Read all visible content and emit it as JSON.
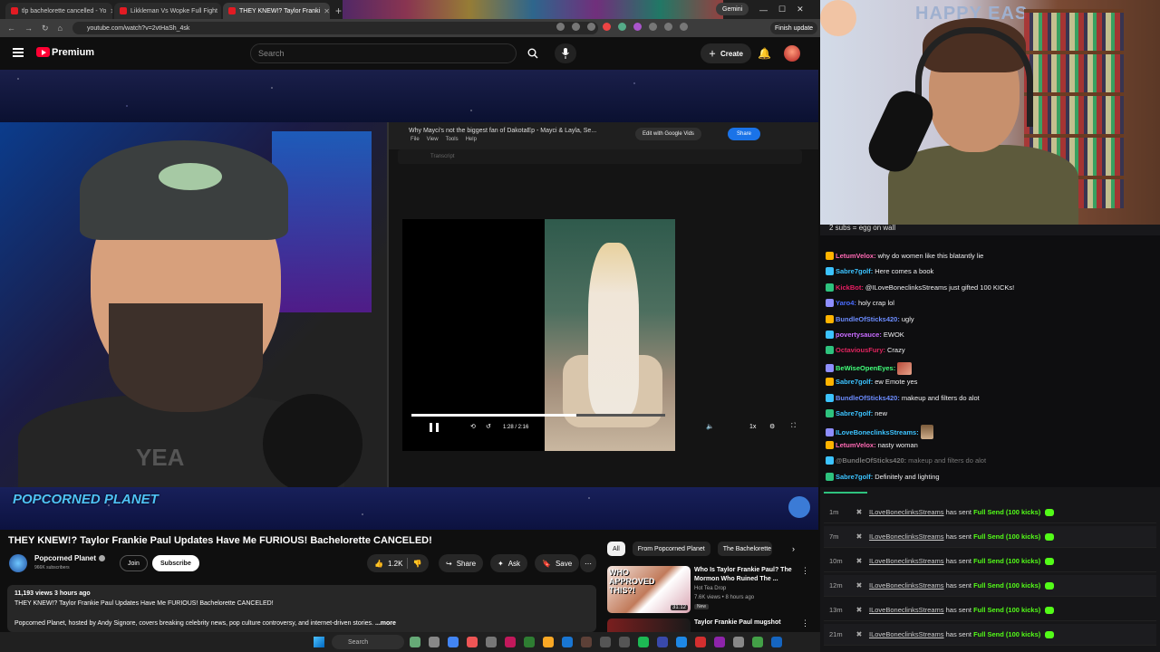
{
  "browser": {
    "tabs": [
      {
        "label": "tlp bachelorette cancelled - Yo"
      },
      {
        "label": "Likkleman Vs Wopke Full Fight"
      },
      {
        "label": "THEY KNEW!? Taylor Franki"
      }
    ],
    "gemini_label": "Gemini",
    "url": "youtube.com/watch?v=2vtHaSh_4sk",
    "finish_update": "Finish update"
  },
  "youtube": {
    "brand": "Premium",
    "search_placeholder": "Search",
    "create_label": "Create"
  },
  "screen_share": {
    "doc_title": "Why Mayci's not the biggest fan of DakotaEp - Mayci & Layla, Se...",
    "doc_menu": [
      "File",
      "View",
      "Tools",
      "Help"
    ],
    "edit_label": "Edit with Google Vids",
    "share_label": "Share",
    "transcript_label": "Transcript",
    "time": "1:28 / 2:16",
    "speed": "1x",
    "progress": 0.65
  },
  "left_cam": {
    "shirt_text": "YEA"
  },
  "banner": {
    "logo": "POPCORNED PLANET"
  },
  "video": {
    "title": "THEY KNEW!? Taylor Frankie Paul Updates Have Me FURIOUS! Bachelorette CANCELED!",
    "channel": "Popcorned Planet",
    "subscribers": "966K subscribers",
    "join": "Join",
    "subscribe": "Subscribe",
    "likes": "1.2K",
    "share": "Share",
    "ask": "Ask",
    "save": "Save",
    "views_time": "11,193 views  3 hours ago",
    "desc_title": "THEY KNEW!? Taylor Frankie Paul Updates Have Me FURIOUS! Bachelorette CANCELED!",
    "desc_body": "Popcorned Planet, hosted by Andy Signore, covers breaking celebrity news, pop culture controversy, and internet-driven stories.",
    "more": "...more"
  },
  "recs": {
    "chips": [
      "All",
      "From Popcorned Planet",
      "The Bachelorette"
    ],
    "items": [
      {
        "thumb_text": "WHO APPROVED THIS?!",
        "duration": "31:12",
        "title": "Who Is Taylor Frankie Paul? The Mormon Who Ruined The ...",
        "channel": "Hot Tea Drop",
        "meta": "7.6K views • 8 hours ago",
        "badge": "New"
      },
      {
        "thumb_text": "",
        "duration": "",
        "title": "Taylor Frankie Paul mugshot",
        "channel": "",
        "meta": "",
        "badge": ""
      }
    ]
  },
  "taskbar": {
    "search": "Search"
  },
  "webcam": {
    "wall_text": "HAPPY EAS"
  },
  "chat": {
    "header": "2 subs = egg on wall",
    "messages": [
      {
        "user": "LetumVelox",
        "text": "why do women like this blatantly lie",
        "color": "#ff69b4"
      },
      {
        "user": "Sabre7golf",
        "text": "Here comes a book",
        "color": "#3cc3ff"
      },
      {
        "user": "KickBot",
        "text": "@ILoveBoneclinksStreams just gifted 100 KICKs!",
        "color": "#e91e63"
      },
      {
        "user": "Yaro4",
        "text": "holy crap lol",
        "color": "#4a6cff"
      },
      {
        "user": "BundleOfSticks420",
        "text": "ugly",
        "color": "#6c8cff"
      },
      {
        "user": "povertysauce",
        "text": "EWOK",
        "color": "#c86bff"
      },
      {
        "user": "OctaviousFury",
        "text": "Crazy",
        "color": "#e0245e"
      },
      {
        "user": "BeWiseOpenEyes",
        "text": "",
        "color": "#41ff7a"
      },
      {
        "user": "Sabre7golf",
        "text": "ew Emote yes",
        "color": "#3cc3ff"
      },
      {
        "user": "BundleOfSticks420",
        "text": "makeup and filters do alot",
        "color": "#6c8cff"
      },
      {
        "user": "Sabre7golf",
        "text": "new",
        "color": "#3cc3ff"
      },
      {
        "user": "ILoveBoneclinksStreams",
        "text": "",
        "color": "#3cc3ff"
      },
      {
        "user": "LetumVelox",
        "text": "nasty woman",
        "color": "#ff69b4"
      },
      {
        "user": "@BundleOfSticks420",
        "text": "makeup and filters do alot",
        "color": "#777777"
      },
      {
        "user": "Sabre7golf",
        "text": "Definitely and lighting",
        "color": "#3cc3ff"
      }
    ]
  },
  "alerts": {
    "items": [
      {
        "ago": "1m",
        "user": "ILoveBoneclinksStreams",
        "action": "has sent",
        "what": "Full Send (100 kicks)"
      },
      {
        "ago": "7m",
        "user": "ILoveBoneclinksStreams",
        "action": "has sent",
        "what": "Full Send (100 kicks)"
      },
      {
        "ago": "10m",
        "user": "ILoveBoneclinksStreams",
        "action": "has sent",
        "what": "Full Send (100 kicks)"
      },
      {
        "ago": "12m",
        "user": "ILoveBoneclinksStreams",
        "action": "has sent",
        "what": "Full Send (100 kicks)"
      },
      {
        "ago": "13m",
        "user": "ILoveBoneclinksStreams",
        "action": "has sent",
        "what": "Full Send (100 kicks)"
      },
      {
        "ago": "21m",
        "user": "ILoveBoneclinksStreams",
        "action": "has sent",
        "what": "Full Send (100 kicks)"
      }
    ]
  },
  "colors": {
    "youtube_red": "#ff0033",
    "kick_green": "#53fc18"
  }
}
